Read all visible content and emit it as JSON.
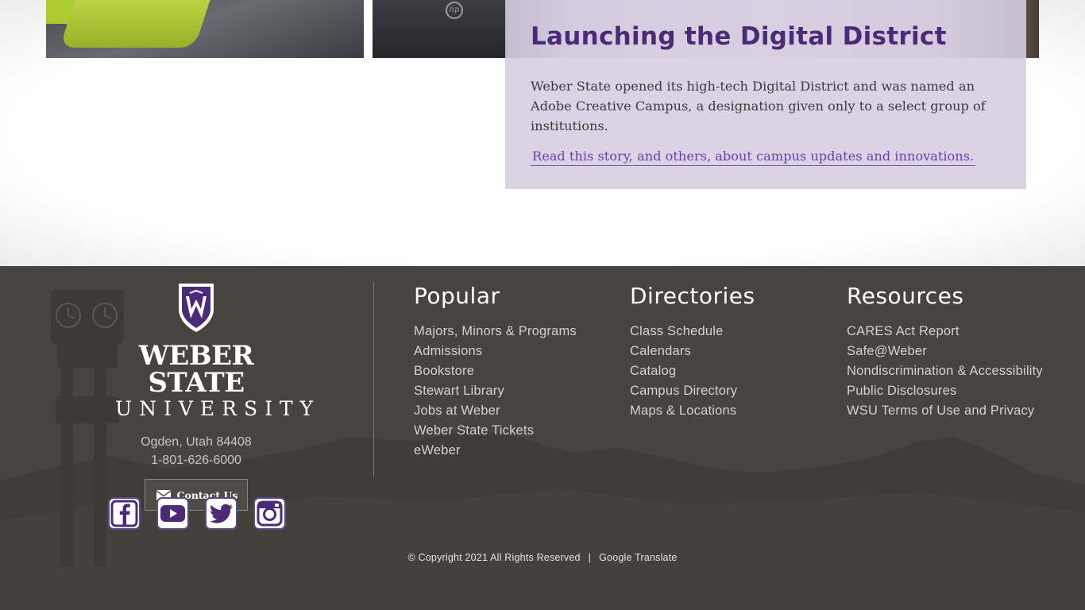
{
  "story": {
    "title": "Launching the Digital District",
    "body": "Weber State opened its high-tech Digital District and was named an Adobe Creative Campus, a designation given only to a select group of institutions.",
    "link_text": "Read this story, and others, about campus updates and innovations."
  },
  "footer": {
    "logo_line1": "WEBER STATE",
    "logo_line2": "UNIVERSITY",
    "address": "Ogden, Utah 84408",
    "phone": "1-801-626-6000",
    "contact_label": "Contact Us",
    "popular": {
      "heading": "Popular",
      "links": [
        "Majors, Minors & Programs",
        "Admissions",
        "Bookstore",
        "Stewart Library",
        "Jobs at Weber",
        "Weber State Tickets",
        "eWeber"
      ]
    },
    "directories": {
      "heading": "Directories",
      "links": [
        "Class Schedule",
        "Calendars",
        "Catalog",
        "Campus Directory",
        "Maps & Locations"
      ]
    },
    "resources": {
      "heading": "Resources",
      "links": [
        "CARES Act Report",
        "Safe@Weber",
        "Nondiscrimination & Accessibility",
        "Public Disclosures",
        "WSU Terms of Use and Privacy"
      ]
    },
    "social_icons": [
      "facebook-icon",
      "youtube-icon",
      "twitter-icon",
      "instagram-icon"
    ],
    "copyright": "© Copyright 2021 All Rights Reserved",
    "separator": "|",
    "translate_label": "Google Translate"
  },
  "colors": {
    "brand_purple": "#4b2a78",
    "footer_bg": "#47443f",
    "card_bg": "#d6cde0"
  }
}
